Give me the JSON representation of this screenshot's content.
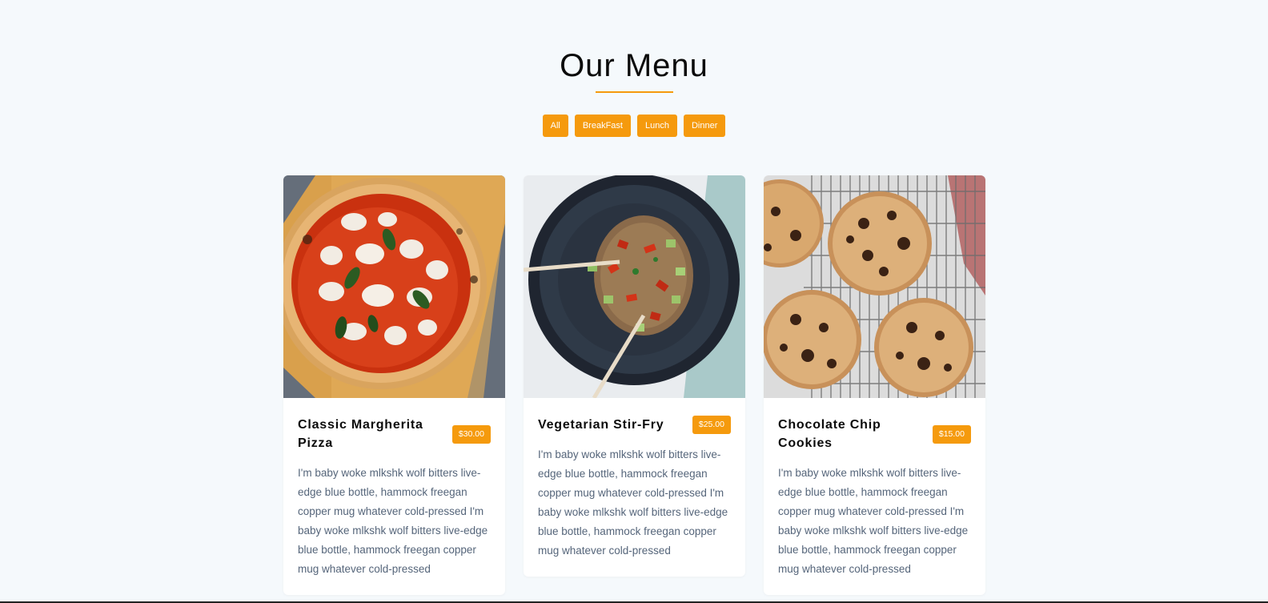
{
  "menu": {
    "title": "Our Menu",
    "accent_color": "#f59a0d",
    "filters": [
      "All",
      "BreakFast",
      "Lunch",
      "Dinner"
    ]
  },
  "items": [
    {
      "title": "Classic Margherita Pizza",
      "price": "$30.00",
      "image": "pizza-image",
      "description": "I'm baby woke mlkshk wolf bitters live-edge blue bottle, hammock freegan copper mug whatever cold-pressed I'm baby woke mlkshk wolf bitters live-edge blue bottle, hammock freegan copper mug whatever cold-pressed"
    },
    {
      "title": "Vegetarian Stir-Fry",
      "price": "$25.00",
      "image": "stir-fry-image",
      "description": "I'm baby woke mlkshk wolf bitters live-edge blue bottle, hammock freegan copper mug whatever cold-pressed I'm baby woke mlkshk wolf bitters live-edge blue bottle, hammock freegan copper mug whatever cold-pressed"
    },
    {
      "title": "Chocolate Chip Cookies",
      "price": "$15.00",
      "image": "cookies-image",
      "description": "I'm baby woke mlkshk wolf bitters live-edge blue bottle, hammock freegan copper mug whatever cold-pressed I'm baby woke mlkshk wolf bitters live-edge blue bottle, hammock freegan copper mug whatever cold-pressed"
    }
  ]
}
